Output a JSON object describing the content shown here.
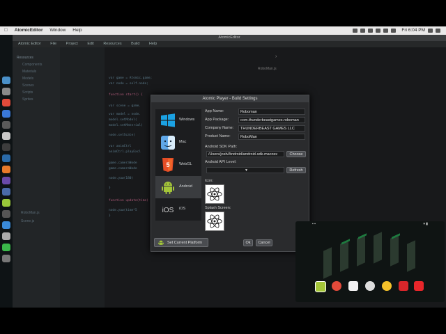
{
  "menubar": {
    "apple": "",
    "app": "AtomicEditor",
    "items": [
      "Window",
      "Help"
    ],
    "clock": "Fri 6:04 PM"
  },
  "window": {
    "title": "AtomicEditor"
  },
  "appmenu": [
    "Atomic Editor",
    "File",
    "Project",
    "Edit",
    "Resources",
    "Build",
    "Help"
  ],
  "sidebar": {
    "root": "Resources",
    "tree": [
      "Components",
      "Materials",
      "Models",
      "Scenes",
      "Scripts",
      "Sprites"
    ],
    "files": [
      "RoboMan.js",
      "Scene.js"
    ]
  },
  "code": {
    "tab": "RoboMan.js",
    "lines": [
      "var game = Atomic.game;",
      "var node = self.node;",
      "",
      "function start() {",
      "  var scene = game.",
      "  var model = node.",
      "  model.setModel(",
      "  model.setMaterial(",
      "",
      "  node.setScale(",
      "",
      "  var animCtrl",
      "  animCtrl.playExcl",
      "",
      "  game.cameraNode",
      "  game.cameraNode",
      "",
      "  node.yaw(180)",
      "}",
      "",
      "function update(time) {",
      "",
      "  node.yaw(time*5",
      "}"
    ]
  },
  "dialog": {
    "title": "Atomic Player - Build Settings",
    "platforms": [
      "Windows",
      "Mac",
      "WebGL",
      "Android",
      "iOS"
    ],
    "fields": {
      "app_name_label": "App Name:",
      "app_name": "Roboman",
      "app_package_label": "App Package:",
      "app_package": "com.thunderbeastgames.roboman",
      "company_label": "Company Name:",
      "company": "THUNDERBEAST GAMES LLC",
      "product_label": "Product Name:",
      "product": "RoboMan",
      "sdk_label": "Android SDK Path:",
      "sdk_path": "/Users/josh/Android/android-sdk-macosx",
      "api_label": "Android API Level:",
      "icon_label": "Icon:",
      "splash_label": "Splash Screen:"
    },
    "buttons": {
      "choose": "Choose",
      "refresh": "Refresh",
      "set_platform": "Set Current Platform",
      "ok": "Ok",
      "cancel": "Cancel"
    }
  },
  "colors": {
    "android_green": "#a4c639",
    "windows_blue": "#1ba1e2",
    "html5_orange": "#e44d26"
  }
}
